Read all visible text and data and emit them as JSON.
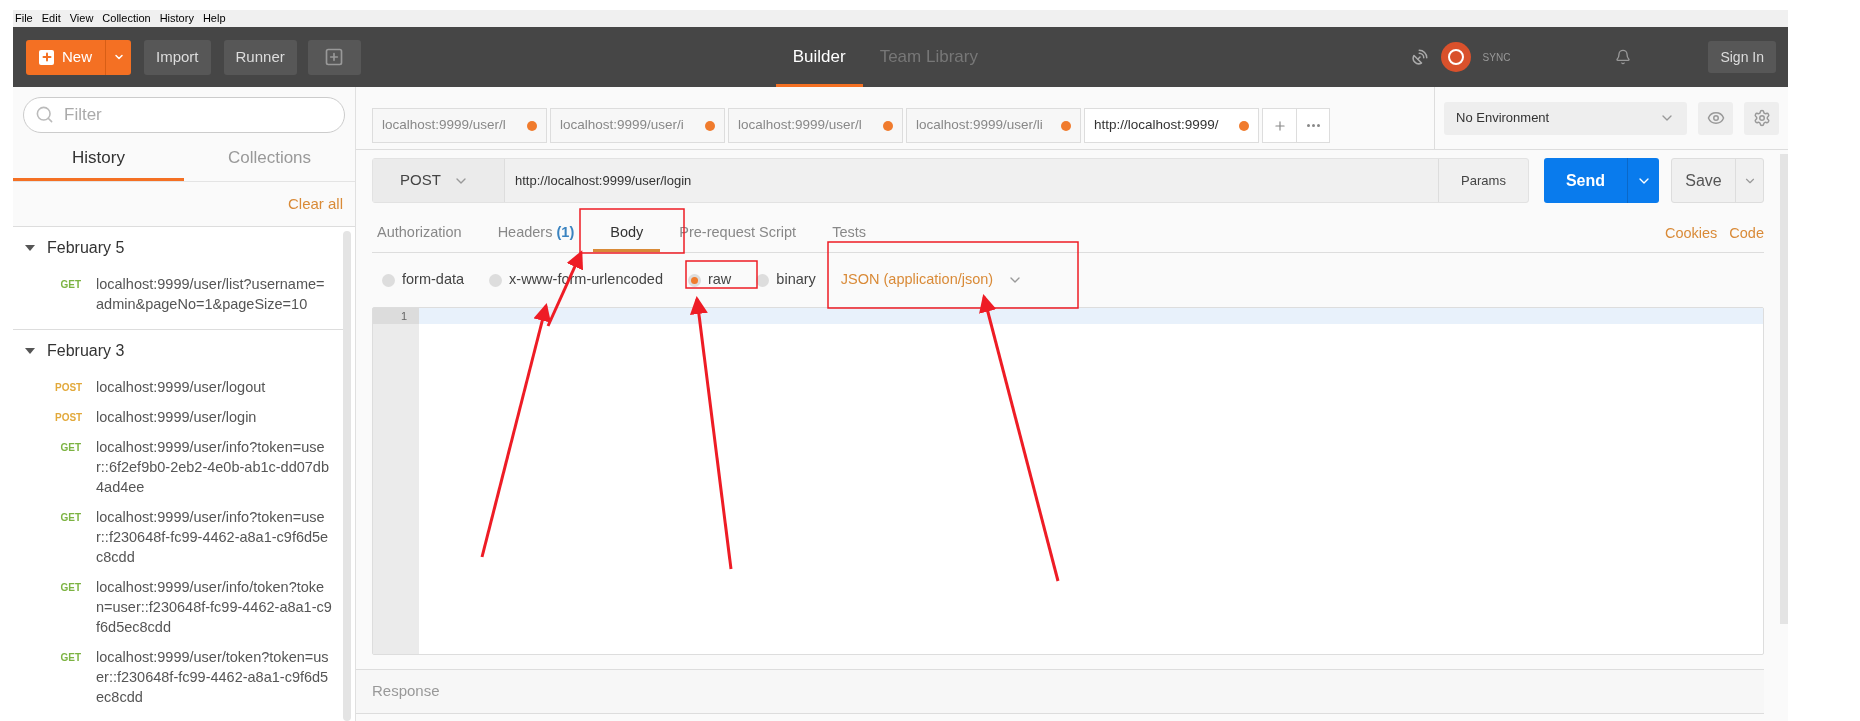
{
  "menu": [
    "File",
    "Edit",
    "View",
    "Collection",
    "History",
    "Help"
  ],
  "toolbar": {
    "new": "New",
    "import": "Import",
    "runner": "Runner"
  },
  "views": [
    {
      "label": "Builder",
      "selected": true
    },
    {
      "label": "Team Library",
      "selected": false
    }
  ],
  "sync": {
    "label": "SYNC"
  },
  "sign_in": "Sign In",
  "sidebar": {
    "filter_placeholder": "Filter",
    "tabs": [
      {
        "label": "History",
        "selected": true
      },
      {
        "label": "Collections",
        "selected": false
      }
    ],
    "clear_all": "Clear all",
    "groups": [
      {
        "date": "February 5",
        "expanded": true,
        "items": [
          {
            "method": "GET",
            "color": "#7cb342",
            "url": "localhost:9999/user/list?username=admin&pageNo=1&pageSize=10"
          }
        ]
      },
      {
        "date": "February 3",
        "expanded": true,
        "items": [
          {
            "method": "POST",
            "color": "#e2a93b",
            "url": "localhost:9999/user/logout"
          },
          {
            "method": "POST",
            "color": "#e2a93b",
            "url": "localhost:9999/user/login"
          },
          {
            "method": "GET",
            "color": "#7cb342",
            "url": "localhost:9999/user/info?token=user::6f2ef9b0-2eb2-4e0b-ab1c-dd07db4ad4ee"
          },
          {
            "method": "GET",
            "color": "#7cb342",
            "url": "localhost:9999/user/info?token=user::f230648f-fc99-4462-a8a1-c9f6d5ec8cdd"
          },
          {
            "method": "GET",
            "color": "#7cb342",
            "url": "localhost:9999/user/info/token?token=user::f230648f-fc99-4462-a8a1-c9f6d5ec8cdd"
          },
          {
            "method": "GET",
            "color": "#7cb342",
            "url": "localhost:9999/user/token?token=user::f230648f-fc99-4462-a8a1-c9f6d5ec8cdd"
          }
        ]
      }
    ]
  },
  "request_tabs": [
    {
      "label": "localhost:9999/user/l",
      "selected": false,
      "unsaved": true
    },
    {
      "label": "localhost:9999/user/i",
      "selected": false,
      "unsaved": true
    },
    {
      "label": "localhost:9999/user/l",
      "selected": false,
      "unsaved": true
    },
    {
      "label": "localhost:9999/user/li",
      "selected": false,
      "unsaved": true
    },
    {
      "label": "http://localhost:9999/",
      "selected": true,
      "unsaved": true
    }
  ],
  "environment": {
    "value": "No Environment"
  },
  "request": {
    "method": "POST",
    "url": "http://localhost:9999/user/login",
    "params": "Params",
    "send": "Send",
    "save": "Save"
  },
  "sections": [
    {
      "label": "Authorization",
      "selected": false
    },
    {
      "label": "Headers",
      "count": "(1)",
      "selected": false
    },
    {
      "label": "Body",
      "selected": true
    },
    {
      "label": "Pre-request Script",
      "selected": false
    },
    {
      "label": "Tests",
      "selected": false
    }
  ],
  "links": [
    "Cookies",
    "Code"
  ],
  "body_modes": [
    {
      "label": "form-data",
      "selected": false
    },
    {
      "label": "x-www-form-urlencoded",
      "selected": false
    },
    {
      "label": "raw",
      "selected": true
    },
    {
      "label": "binary",
      "selected": false
    }
  ],
  "content_type": "JSON (application/json)",
  "editor": {
    "line_numbers": [
      "1"
    ]
  },
  "response": {
    "label": "Response"
  }
}
